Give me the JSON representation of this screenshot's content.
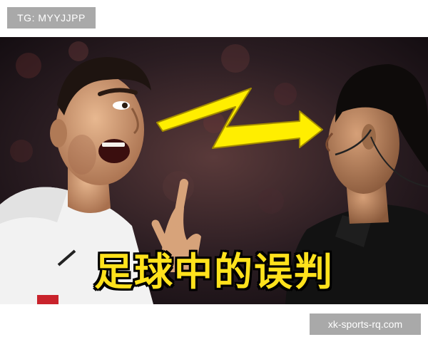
{
  "watermark_top": "TG: MYYJJPP",
  "caption": "足球中的误判",
  "watermark_bottom": "xk-sports-rq.com",
  "colors": {
    "caption_fill": "#ffe21c",
    "caption_stroke": "#000000",
    "arrow": "#ffee00",
    "watermark_bg": "#a9a9a9",
    "jersey_left": "#f2f2f2",
    "jersey_right": "#121212"
  },
  "icons": [
    "zigzag-arrow-icon"
  ]
}
